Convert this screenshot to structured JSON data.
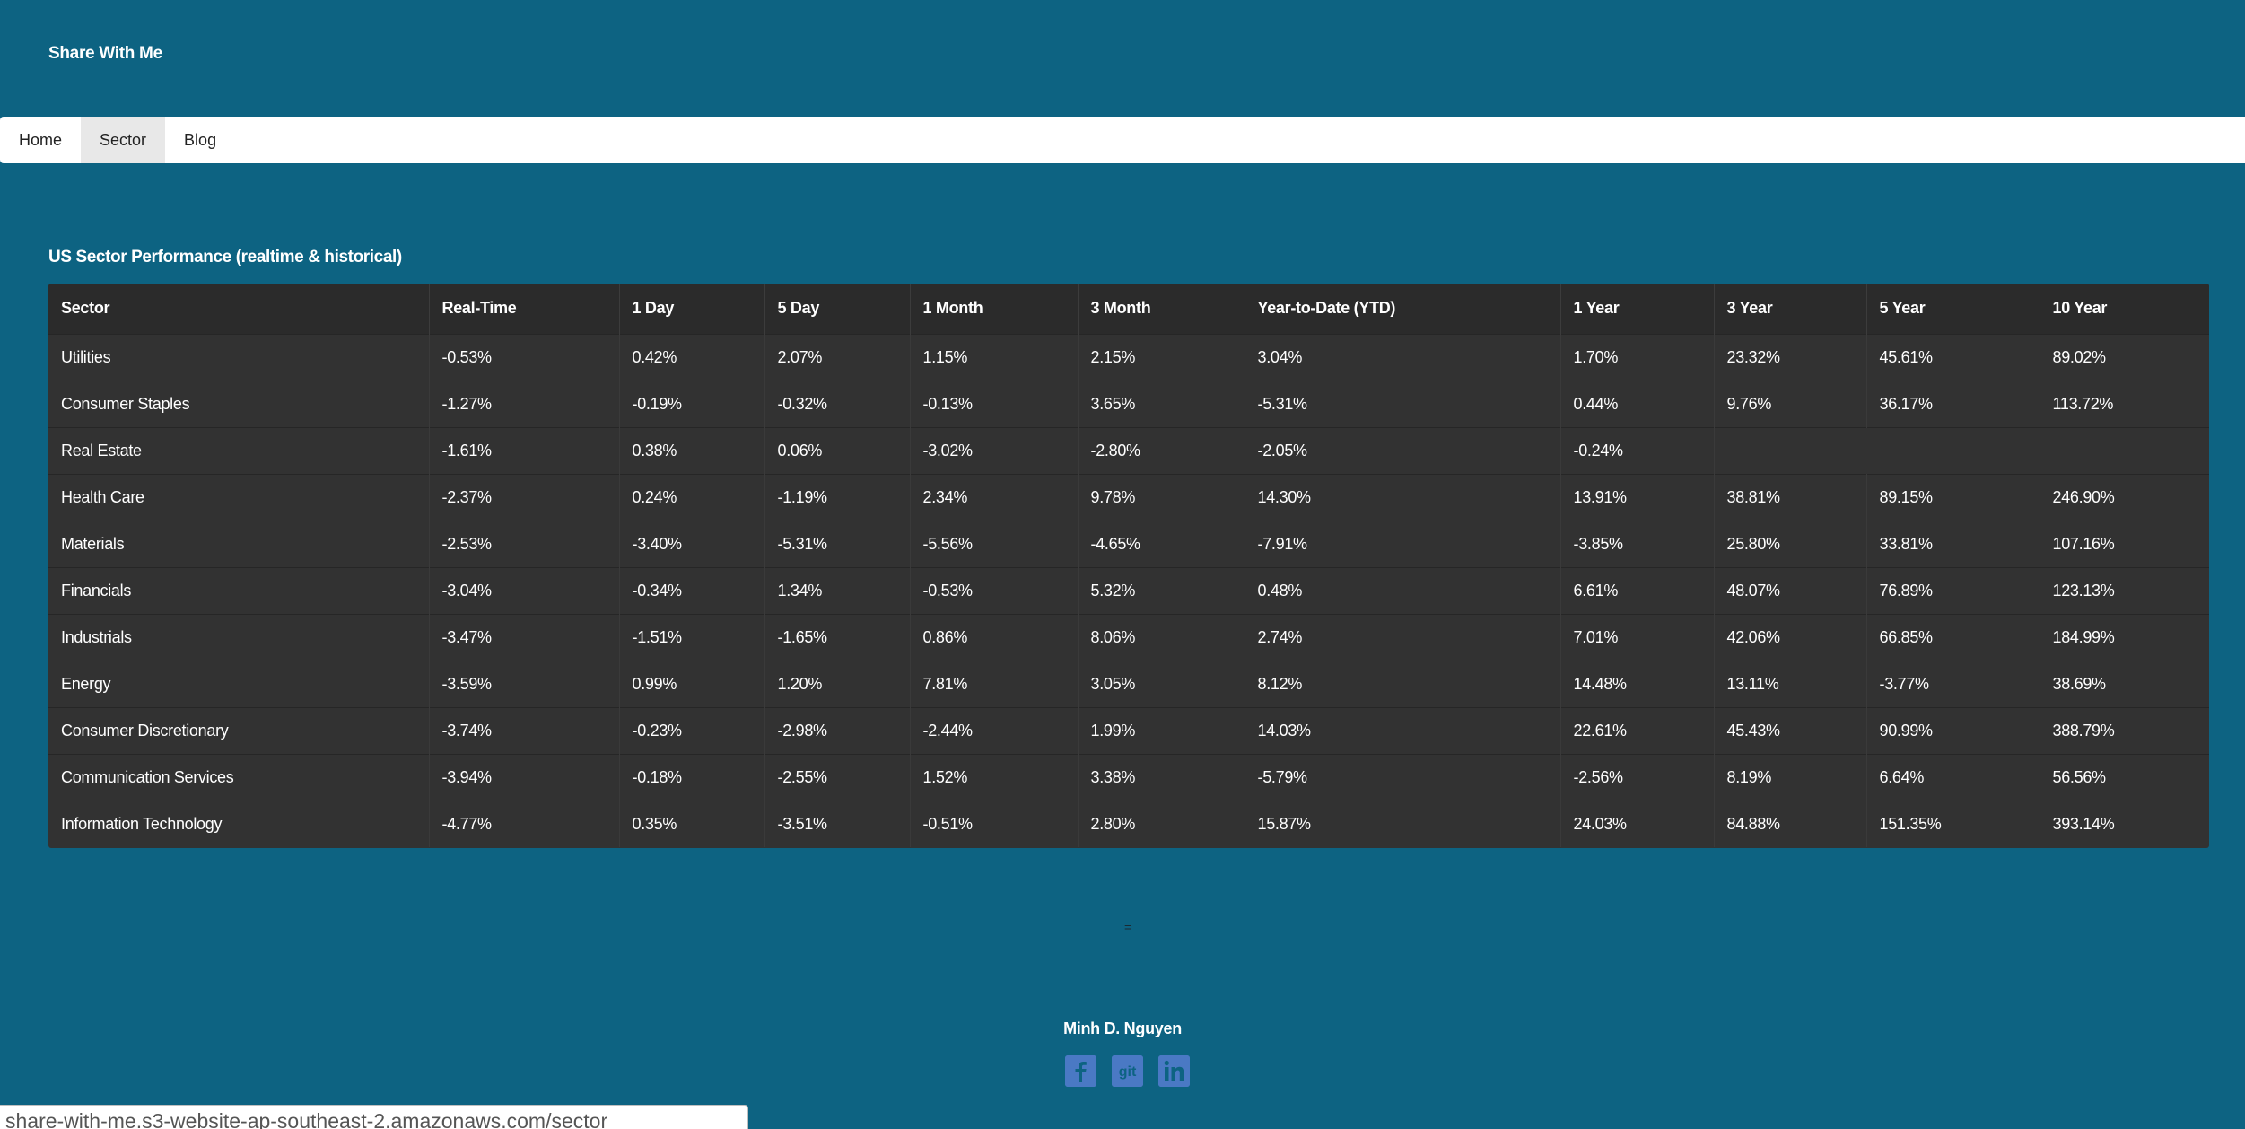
{
  "header": {
    "site_title": "Share With Me"
  },
  "nav": {
    "items": [
      {
        "label": "Home",
        "active": false
      },
      {
        "label": "Sector",
        "active": true
      },
      {
        "label": "Blog",
        "active": false
      }
    ]
  },
  "main": {
    "caption": "US Sector Performance (realtime & historical)",
    "table": {
      "columns": [
        "Sector",
        "Real-Time",
        "1 Day",
        "5 Day",
        "1 Month",
        "3 Month",
        "Year-to-Date (YTD)",
        "1 Year",
        "3 Year",
        "5 Year",
        "10 Year"
      ],
      "rows": [
        [
          "Utilities",
          "-0.53%",
          "0.42%",
          "2.07%",
          "1.15%",
          "2.15%",
          "3.04%",
          "1.70%",
          "23.32%",
          "45.61%",
          "89.02%"
        ],
        [
          "Consumer Staples",
          "-1.27%",
          "-0.19%",
          "-0.32%",
          "-0.13%",
          "3.65%",
          "-5.31%",
          "0.44%",
          "9.76%",
          "36.17%",
          "113.72%"
        ],
        [
          "Real Estate",
          "-1.61%",
          "0.38%",
          "0.06%",
          "-3.02%",
          "-2.80%",
          "-2.05%",
          "-0.24%",
          "",
          "",
          ""
        ],
        [
          "Health Care",
          "-2.37%",
          "0.24%",
          "-1.19%",
          "2.34%",
          "9.78%",
          "14.30%",
          "13.91%",
          "38.81%",
          "89.15%",
          "246.90%"
        ],
        [
          "Materials",
          "-2.53%",
          "-3.40%",
          "-5.31%",
          "-5.56%",
          "-4.65%",
          "-7.91%",
          "-3.85%",
          "25.80%",
          "33.81%",
          "107.16%"
        ],
        [
          "Financials",
          "-3.04%",
          "-0.34%",
          "1.34%",
          "-0.53%",
          "5.32%",
          "0.48%",
          "6.61%",
          "48.07%",
          "76.89%",
          "123.13%"
        ],
        [
          "Industrials",
          "-3.47%",
          "-1.51%",
          "-1.65%",
          "0.86%",
          "8.06%",
          "2.74%",
          "7.01%",
          "42.06%",
          "66.85%",
          "184.99%"
        ],
        [
          "Energy",
          "-3.59%",
          "0.99%",
          "1.20%",
          "7.81%",
          "3.05%",
          "8.12%",
          "14.48%",
          "13.11%",
          "-3.77%",
          "38.69%"
        ],
        [
          "Consumer Discretionary",
          "-3.74%",
          "-0.23%",
          "-2.98%",
          "-2.44%",
          "1.99%",
          "14.03%",
          "22.61%",
          "45.43%",
          "90.99%",
          "388.79%"
        ],
        [
          "Communication Services",
          "-3.94%",
          "-0.18%",
          "-2.55%",
          "1.52%",
          "3.38%",
          "-5.79%",
          "-2.56%",
          "8.19%",
          "6.64%",
          "56.56%"
        ],
        [
          "Information Technology",
          "-4.77%",
          "0.35%",
          "-3.51%",
          "-0.51%",
          "2.80%",
          "15.87%",
          "24.03%",
          "84.88%",
          "151.35%",
          "393.14%"
        ]
      ]
    },
    "divider_text": "="
  },
  "footer": {
    "author": "Minh D. Nguyen",
    "social": [
      {
        "icon": "facebook-icon",
        "text": "f"
      },
      {
        "icon": "git-icon",
        "text": "git"
      },
      {
        "icon": "linkedin-icon",
        "text": "in"
      }
    ]
  },
  "status_bar": {
    "url": "share-with-me.s3-website-ap-southeast-2.amazonaws.com/sector"
  },
  "colors": {
    "page_background": "#0d6382",
    "table_background": "#323232",
    "header_background": "#2b2b2b",
    "navbar_background": "#ffffff",
    "social_icon": "#4a79c4"
  }
}
